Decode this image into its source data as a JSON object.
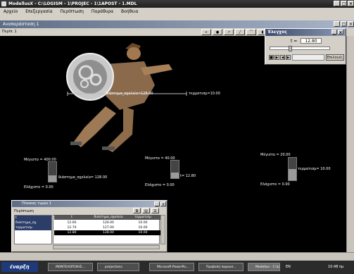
{
  "window": {
    "title": "ModellusX - C:\\LOGISM - 1\\PROJEC - 1\\1APOST - 1.MDL"
  },
  "menu": [
    "Αρχείο",
    "Επεξεργασία",
    "Περίπτωση",
    "Παράθυρα",
    "Βοήθεια"
  ],
  "animation_window": {
    "title": "Αναπαράσταση 1",
    "page_label": "Περίπ. 1"
  },
  "canvas": {
    "runner_label": "διάστημα_σχολείο=128.00",
    "distance_label": "τερματισμ=10.00",
    "meters": [
      {
        "name": "distance",
        "max_label": "Μέγιστο = 400.00",
        "min_label": "Ελάχιστο = 0.00",
        "value_label": "διάστημα_σχολείο= 128.00",
        "fraction": 0.32
      },
      {
        "name": "time",
        "max_label": "Μέγιστο = 40.00",
        "min_label": "Ελάχιστο = 0.00",
        "value_label": "t= 12.80",
        "fraction": 0.32
      },
      {
        "name": "finish",
        "max_label": "Μέγιστο = 20.00",
        "min_label": "Ελάχιστο = 0.00",
        "value_label": "τερματισμ= 10.00",
        "fraction": 0.5
      }
    ]
  },
  "control": {
    "title": "Έλεγχος",
    "time_label": "t =",
    "time_value": "12.80",
    "options_label": "Επιλογές",
    "slider_fraction": 0.32
  },
  "table": {
    "title": "Πίνακας τιμών 1",
    "page_label": "Περίπτωση",
    "variables": [
      "t",
      "διάστημα_σχολείο",
      "τερματισμ"
    ],
    "left_list": [
      "t",
      "διάστημα_σχ.",
      "τερματισμ"
    ],
    "rows": [
      [
        "12.60",
        "126.00",
        "10.00"
      ],
      [
        "12.70",
        "127.00",
        "10.00"
      ],
      [
        "12.80",
        "128.00",
        "10.00"
      ]
    ]
  },
  "taskbar": {
    "start": "έναρξη",
    "items": [
      "ΜΟΝΤΕΛΟΠΟΙΗΣ...",
      "projections",
      "Microsoft PowerPo...",
      "Προβολή παρουσ...",
      "Modellus - C:\\LOG..."
    ],
    "tray": "EN",
    "clock": "10:48 πμ"
  },
  "colors": {
    "canvas": "#000000",
    "accent": "#5e6d87"
  }
}
